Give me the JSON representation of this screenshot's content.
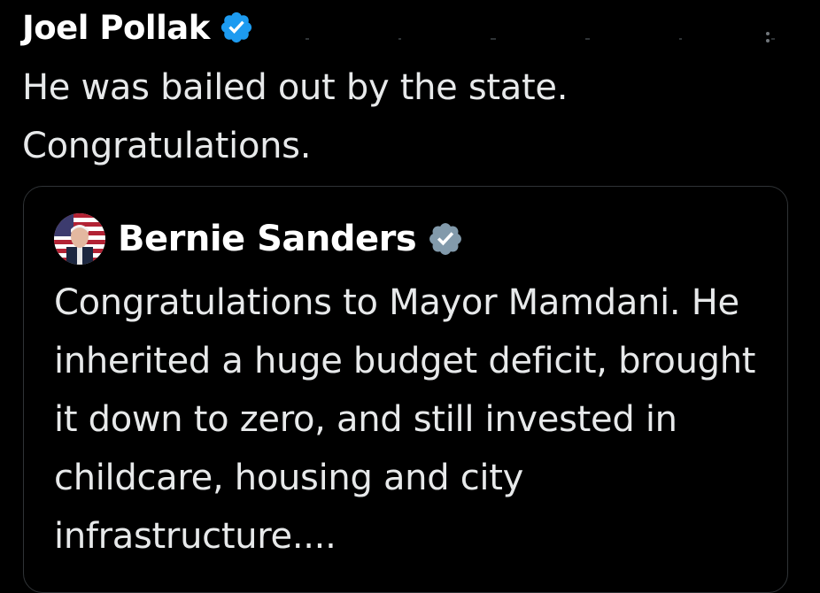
{
  "tweet": {
    "author_name": "Joel Pollak",
    "author_verified_icon": "verified-badge-icon",
    "text": "He was bailed out by the state.\nCongratulations.",
    "more_icon": "more-options-icon"
  },
  "quoted_tweet": {
    "author_name": "Bernie Sanders",
    "author_verified_icon": "verified-badge-icon",
    "avatar_icon": "avatar",
    "text": "Congratulations to Mayor Mamdani. He inherited a huge budget deficit, brought it down to zero, and still invested in childcare, housing and city infrastructure...."
  },
  "colors": {
    "background": "#000000",
    "text": "#e7e9ea",
    "name": "#ffffff",
    "verified_blue": "#1d9bf0",
    "verified_gray": "#829aab",
    "border": "#2f3336"
  }
}
